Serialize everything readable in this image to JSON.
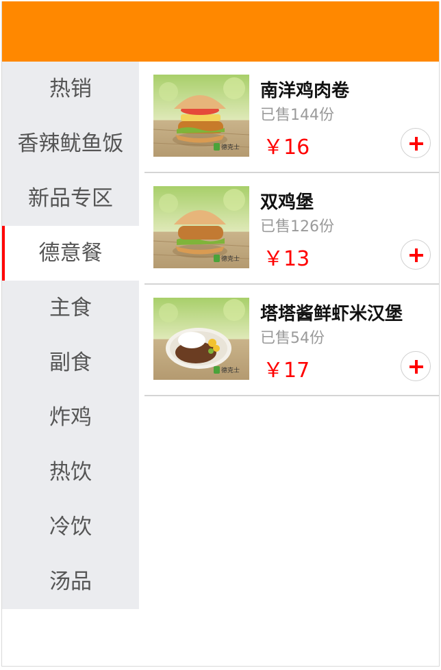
{
  "header": {
    "color": "#ff8800"
  },
  "sidebar": {
    "active_index": 3,
    "active_indicator_color": "#ff0000",
    "items": [
      {
        "label": "热销"
      },
      {
        "label": "香辣鱿鱼饭"
      },
      {
        "label": "新品专区"
      },
      {
        "label": "德意餐"
      },
      {
        "label": "主食"
      },
      {
        "label": "副食"
      },
      {
        "label": "炸鸡"
      },
      {
        "label": "热饮"
      },
      {
        "label": "冷饮"
      },
      {
        "label": "汤品"
      }
    ]
  },
  "products": [
    {
      "name": "南洋鸡肉卷",
      "sold": "已售144份",
      "price": "￥16",
      "image": "chicken-burger-photo",
      "brand": "德克士"
    },
    {
      "name": "双鸡堡",
      "sold": "已售126份",
      "price": "￥13",
      "image": "double-chicken-burger-photo",
      "brand": "德克士"
    },
    {
      "name": "塔塔酱鲜虾米汉堡",
      "sold": "已售54份",
      "price": "￥17",
      "image": "rice-bowl-photo",
      "brand": "德克士"
    }
  ],
  "icons": {
    "add": "plus-circle-icon"
  },
  "colors": {
    "price": "#ff0000",
    "add_icon": "#ff0000"
  }
}
